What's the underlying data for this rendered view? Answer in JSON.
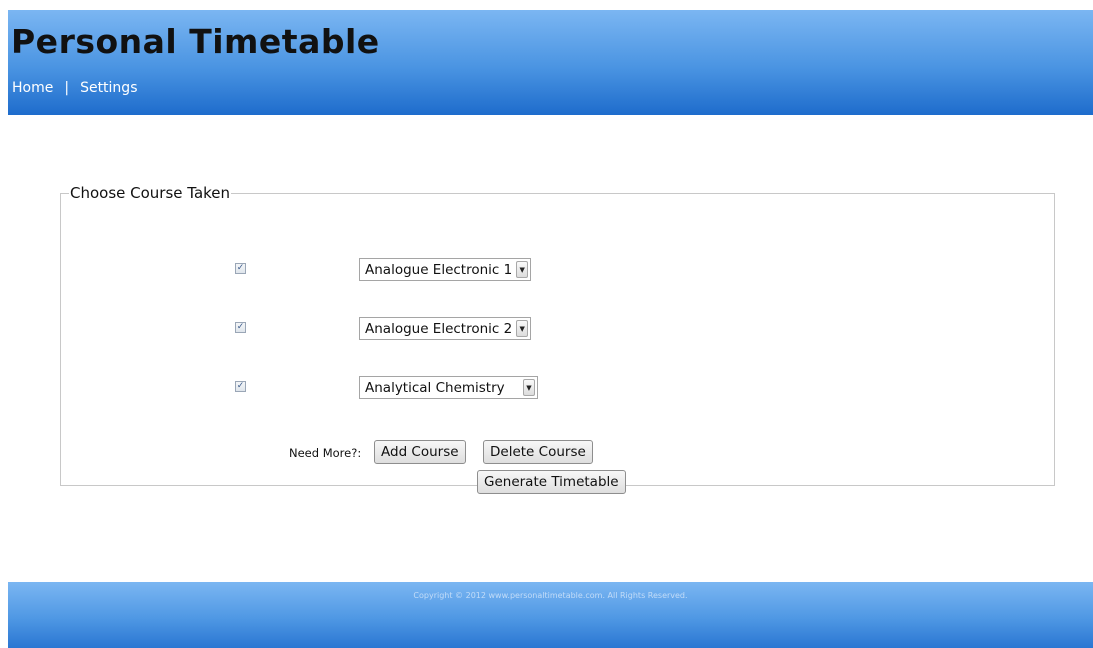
{
  "header": {
    "title": "Personal Timetable",
    "nav": {
      "home": "Home",
      "separator": "|",
      "settings": "Settings"
    }
  },
  "form": {
    "legend": "Choose Course Taken",
    "courses": [
      {
        "checked": true,
        "selected": "Analogue Electronic 1"
      },
      {
        "checked": true,
        "selected": "Analogue Electronic 2"
      },
      {
        "checked": true,
        "selected": "Analytical Chemistry"
      }
    ],
    "need_more_label": "Need More?:",
    "add_course_label": "Add Course",
    "delete_course_label": "Delete Course",
    "generate_label": "Generate Timetable"
  },
  "footer": {
    "copyright": "Copyright © 2012 www.personaltimetable.com. All Rights Reserved."
  },
  "colors": {
    "header_gradient_top": "#7bb6f2",
    "header_gradient_bottom": "#1e6ccc",
    "checkbox_mark": "#3a5a8a"
  },
  "icons": {
    "checkbox": "check-mark",
    "dropdown": "chevron-down-icon"
  }
}
